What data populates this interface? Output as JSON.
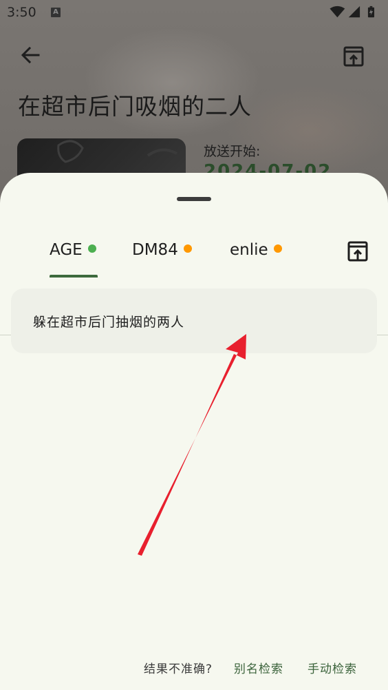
{
  "status_bar": {
    "time": "3:50",
    "notification_icon": "a-letter-icon",
    "icons": [
      "wifi-icon",
      "signal-icon",
      "battery-icon"
    ]
  },
  "background_page": {
    "title": "在超市后门吸烟的二人",
    "airing_label": "放送开始:",
    "airing_date": "2024-07-02",
    "icons": {
      "back": "arrow-back-icon",
      "open": "open-external-icon"
    }
  },
  "sheet": {
    "tabs": [
      {
        "label": "AGE",
        "status_color": "#4caf50",
        "selected": true
      },
      {
        "label": "DM84",
        "status_color": "#ff9800",
        "selected": false
      },
      {
        "label": "enlie",
        "status_color": "#ff9800",
        "selected": false
      }
    ],
    "open_icon": "open-external-icon",
    "results": [
      {
        "title": "躲在超市后门抽烟的两人"
      }
    ],
    "footer": {
      "question": "结果不准确?",
      "alias_search": "别名检索",
      "manual_search": "手动检索"
    }
  },
  "annotation": {
    "type": "red-arrow",
    "color": "#e8202e"
  },
  "colors": {
    "accent": "#3d6a3d",
    "sheet_background": "#f6f8ef",
    "card_background": "#eef0e8"
  }
}
